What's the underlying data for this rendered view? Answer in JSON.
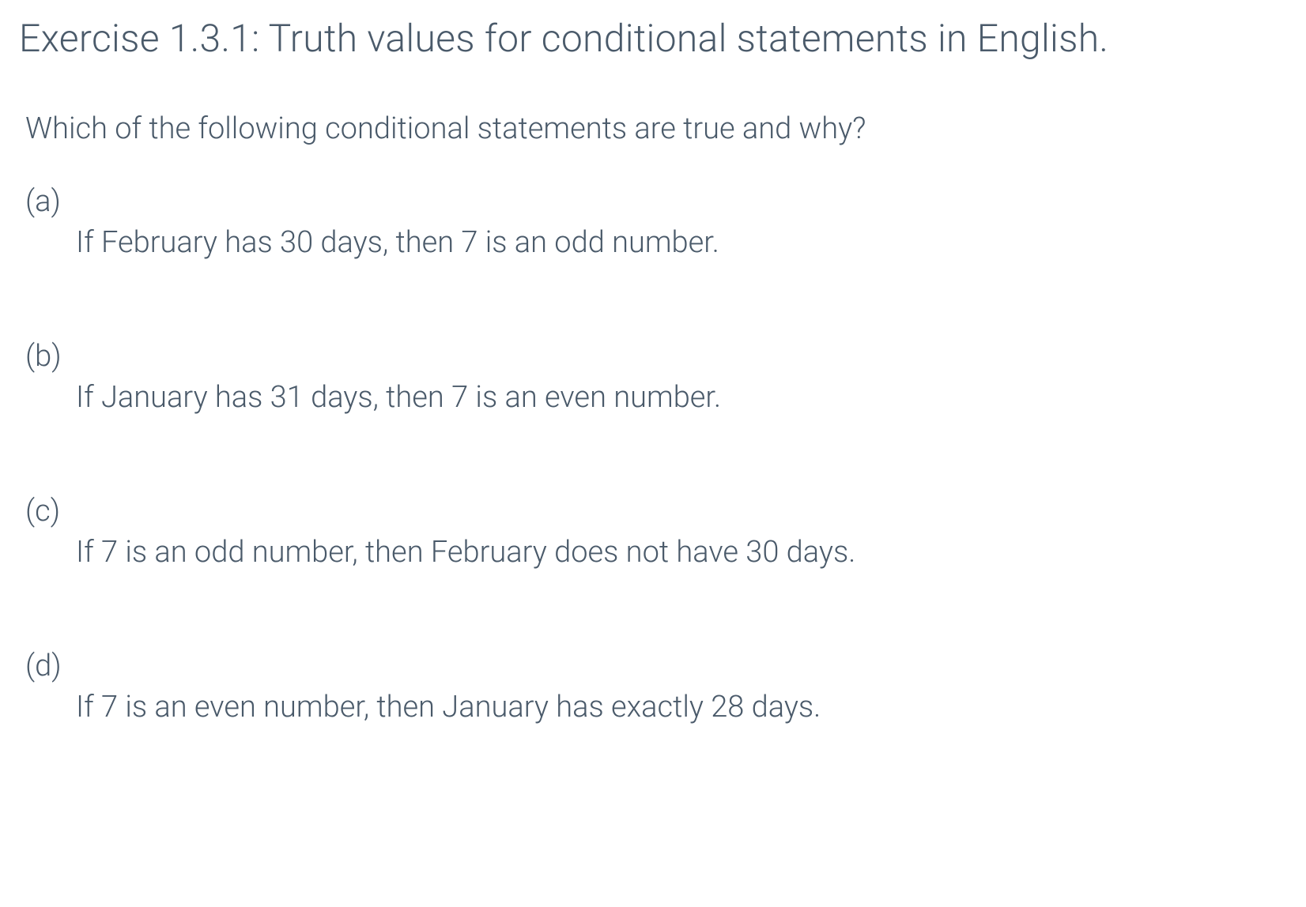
{
  "title": "Exercise 1.3.1: Truth values for conditional statements in English.",
  "question": "Which of the following conditional statements are true and why?",
  "items": [
    {
      "label": "(a)",
      "statement": "If February has 30 days, then 7 is an odd number."
    },
    {
      "label": "(b)",
      "statement": "If January has 31 days, then 7 is an even number."
    },
    {
      "label": "(c)",
      "statement": "If 7 is an odd number, then February does not have 30 days."
    },
    {
      "label": "(d)",
      "statement": "If 7 is an even number, then January has exactly 28 days."
    }
  ]
}
